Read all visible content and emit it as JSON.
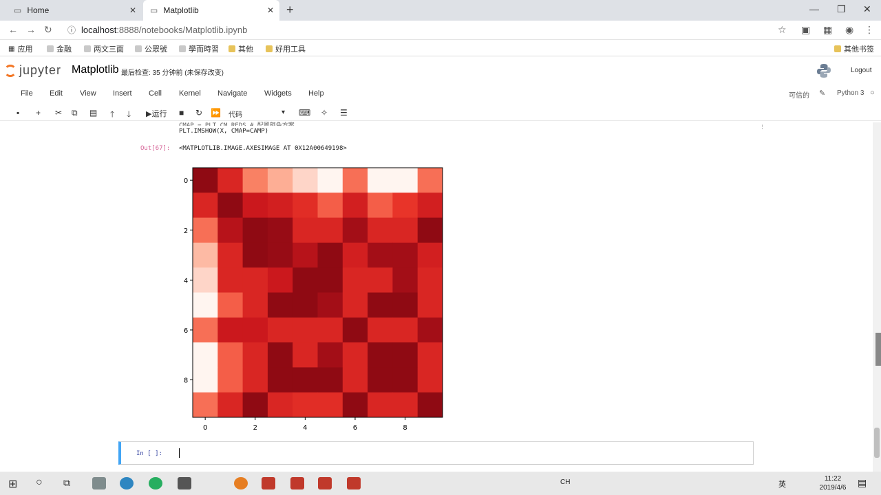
{
  "browser": {
    "tabs": [
      {
        "label": "Home"
      },
      {
        "label": "Matplotlib"
      }
    ],
    "url_host": "localhost",
    "url_path": ":8888/notebooks/Matplotlib.ipynb",
    "bookmarks": [
      "应用",
      "金融",
      "两文三面",
      "公眾號",
      "學而時習",
      "其他",
      "好用工具"
    ],
    "other_bookmarks": "其他书签"
  },
  "jupyter": {
    "logo_text": "jupyter",
    "notebook_name": "Matplotlib",
    "checkpoint": "最后检查: 35 分钟前  (未保存改变)",
    "logout": "Logout",
    "menu": [
      "File",
      "Edit",
      "View",
      "Insert",
      "Cell",
      "Kernel",
      "Navigate",
      "Widgets",
      "Help"
    ],
    "trusted": "可信的",
    "kernel": "Python 3",
    "run_label": "运行",
    "cell_type": "代码"
  },
  "cell": {
    "code_line1": "CMAP = PLT.CM.REDS   # 配置颜色方案",
    "code_line2": "PLT.IMSHOW(X, CMAP=CAMP)",
    "out_prompt": "Out[67]:",
    "output_text": "<MATPLOTLIB.IMAGE.AXESIMAGE AT 0X12A00649198>",
    "in_prompt": "In [ ]:"
  },
  "chart_data": {
    "type": "heatmap",
    "colormap": "Reds",
    "x_ticks": [
      "0",
      "2",
      "4",
      "6",
      "8"
    ],
    "y_ticks": [
      "0",
      "2",
      "4",
      "6",
      "8"
    ],
    "xlim": [
      -0.5,
      9.5
    ],
    "ylim": [
      9.5,
      -0.5
    ],
    "grid": false,
    "values": [
      [
        0.9,
        0.65,
        0.3,
        0.18,
        0.08,
        0.0,
        0.35,
        0.0,
        0.0,
        0.35
      ],
      [
        0.65,
        0.9,
        0.75,
        0.7,
        0.6,
        0.4,
        0.7,
        0.4,
        0.55,
        0.7
      ],
      [
        0.35,
        0.8,
        0.9,
        0.88,
        0.65,
        0.65,
        0.85,
        0.65,
        0.65,
        0.9
      ],
      [
        0.15,
        0.65,
        0.9,
        0.88,
        0.8,
        0.9,
        0.7,
        0.85,
        0.85,
        0.7
      ],
      [
        0.08,
        0.65,
        0.65,
        0.75,
        0.9,
        0.9,
        0.65,
        0.65,
        0.85,
        0.65
      ],
      [
        0.0,
        0.4,
        0.65,
        0.9,
        0.9,
        0.85,
        0.65,
        0.9,
        0.9,
        0.65
      ],
      [
        0.35,
        0.75,
        0.75,
        0.65,
        0.65,
        0.65,
        0.9,
        0.65,
        0.65,
        0.85
      ],
      [
        0.0,
        0.4,
        0.65,
        0.9,
        0.65,
        0.85,
        0.65,
        0.9,
        0.9,
        0.65
      ],
      [
        0.0,
        0.4,
        0.65,
        0.9,
        0.9,
        0.9,
        0.65,
        0.9,
        0.9,
        0.65
      ],
      [
        0.35,
        0.65,
        0.9,
        0.65,
        0.6,
        0.6,
        0.9,
        0.65,
        0.65,
        0.9
      ]
    ]
  },
  "taskbar": {
    "time": "11:22",
    "date": "2019/4/6",
    "ime1": "CH",
    "ime2": "英"
  },
  "colors": {
    "jupyter_orange": "#f37726",
    "cell_edit_border": "#42a5f5"
  }
}
